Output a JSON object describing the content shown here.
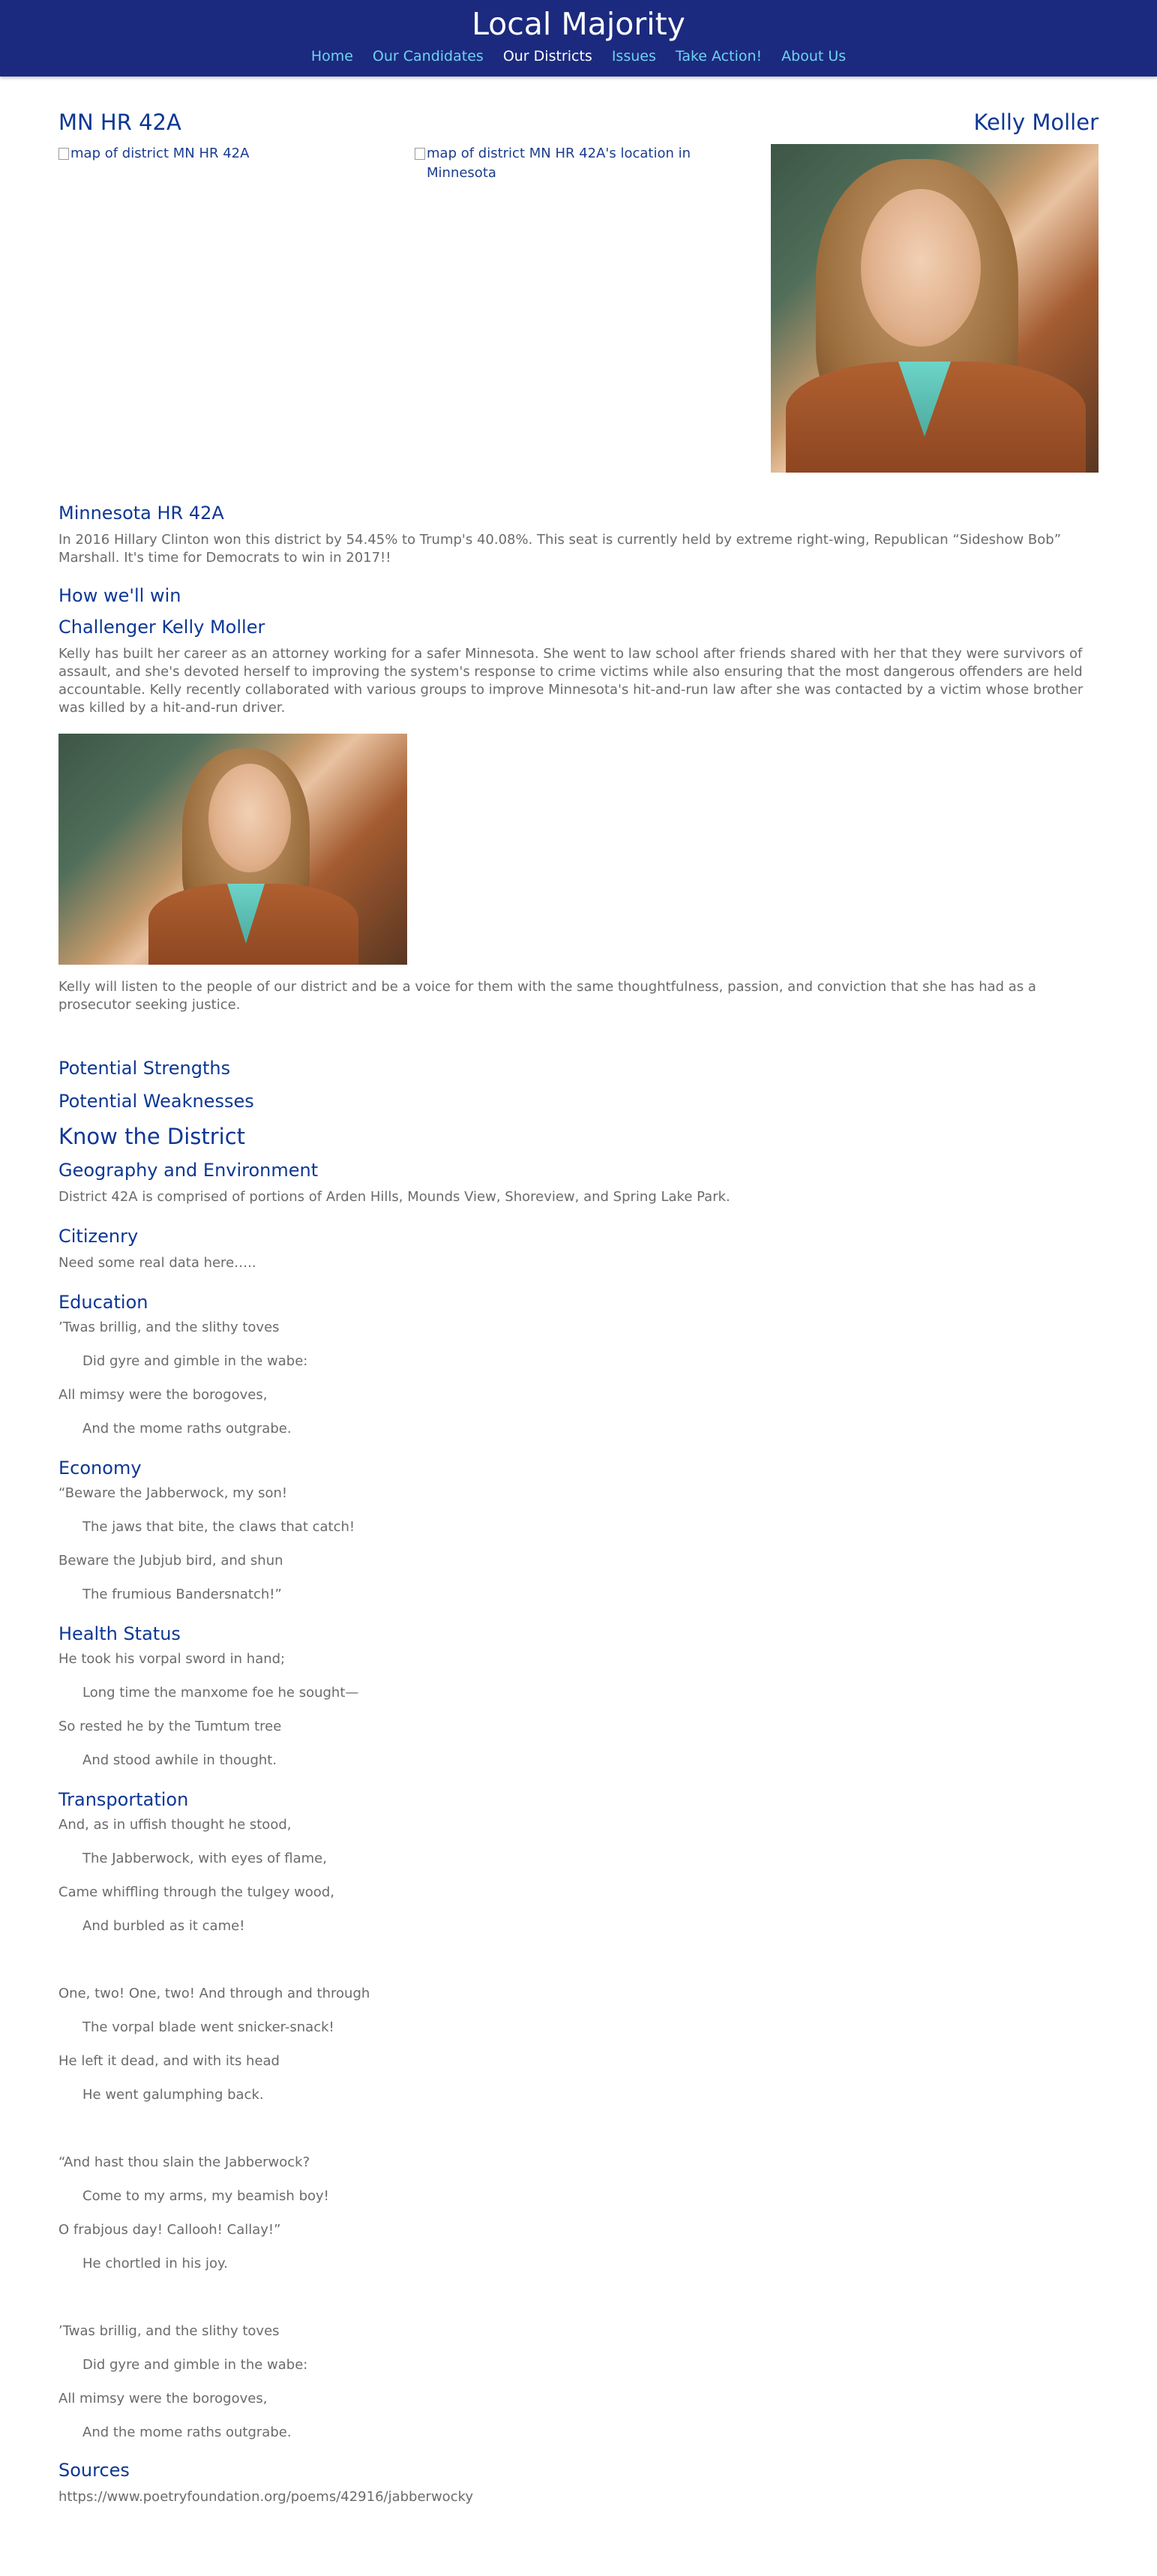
{
  "site": {
    "title": "Local Majority"
  },
  "nav": [
    {
      "label": "Home",
      "active": false
    },
    {
      "label": "Our Candidates",
      "active": false
    },
    {
      "label": "Our Districts",
      "active": true
    },
    {
      "label": "Issues",
      "active": false
    },
    {
      "label": "Take Action!",
      "active": false
    },
    {
      "label": "About Us",
      "active": false
    }
  ],
  "header": {
    "district": "MN HR 42A",
    "candidate": "Kelly Moller"
  },
  "images": {
    "map_alt": "map of district MN HR 42A",
    "location_alt": "map of district MN HR 42A's location in Minnesota"
  },
  "district_section": {
    "heading": "Minnesota HR 42A",
    "body": "In 2016 Hillary Clinton won this district by 54.45% to Trump's 40.08%. This seat is currently held by extreme right-wing, Republican “Sideshow Bob” Marshall. It's time for Democrats to win in 2017!!"
  },
  "how_win": "How we'll win",
  "challenger": {
    "heading": "Challenger Kelly Moller",
    "bio": "Kelly has built her career as an attorney working for a safer Minnesota. She went to law school after friends shared with her that they were survivors of assault, and she's devoted herself to improving the system's response to crime victims while also ensuring that the most dangerous offenders are held accountable. Kelly recently collaborated with various groups to improve Minnesota's hit-and-run law after she was contacted by a victim whose brother was killed by a hit-and-run driver.",
    "closing": "Kelly will listen to the people of our district and be a voice for them with the same thoughtfulness, passion, and conviction that she has had as a prosecutor seeking justice."
  },
  "strengths": "Potential Strengths",
  "weaknesses": "Potential Weaknesses",
  "know": "Know the District",
  "geography": {
    "heading": "Geography and Environment",
    "body": "District 42A is comprised of portions of Arden Hills, Mounds View, Shoreview, and Spring Lake Park."
  },
  "citizenry": {
    "heading": "Citizenry",
    "body": "Need some real data here….."
  },
  "education": {
    "heading": "Education",
    "lines": [
      "’Twas brillig, and the slithy toves",
      "Did gyre and gimble in the wabe:",
      "All mimsy were the borogoves,",
      "And the mome raths outgrabe."
    ]
  },
  "economy": {
    "heading": "Economy",
    "lines": [
      "“Beware the Jabberwock, my son!",
      "The jaws that bite, the claws that catch!",
      "Beware the Jubjub bird, and shun",
      "The frumious Bandersnatch!”"
    ]
  },
  "health": {
    "heading": "Health Status",
    "lines": [
      "He took his vorpal sword in hand;",
      "Long time the manxome foe he sought—",
      "So rested he by the Tumtum tree",
      "And stood awhile in thought."
    ]
  },
  "transportation": {
    "heading": "Transportation",
    "stanzas": [
      [
        " And, as in uffish thought he stood,",
        "The Jabberwock, with eyes of flame,",
        "Came whiffling through the tulgey wood,",
        "And burbled as it came!"
      ],
      [
        "One, two! One, two! And through and through",
        "The vorpal blade went snicker-snack!",
        "He left it dead, and with its head",
        "He went galumphing back."
      ],
      [
        "“And hast thou slain the Jabberwock?",
        "Come to my arms, my beamish boy!",
        "O frabjous day! Callooh! Callay!”",
        "He chortled in his joy."
      ],
      [
        "’Twas brillig, and the slithy toves",
        "Did gyre and gimble in the wabe:",
        "All mimsy were the borogoves,",
        "And the mome raths outgrabe."
      ]
    ]
  },
  "sources": {
    "heading": "Sources",
    "link": "https://www.poetryfoundation.org/poems/42916/jabberwocky"
  }
}
